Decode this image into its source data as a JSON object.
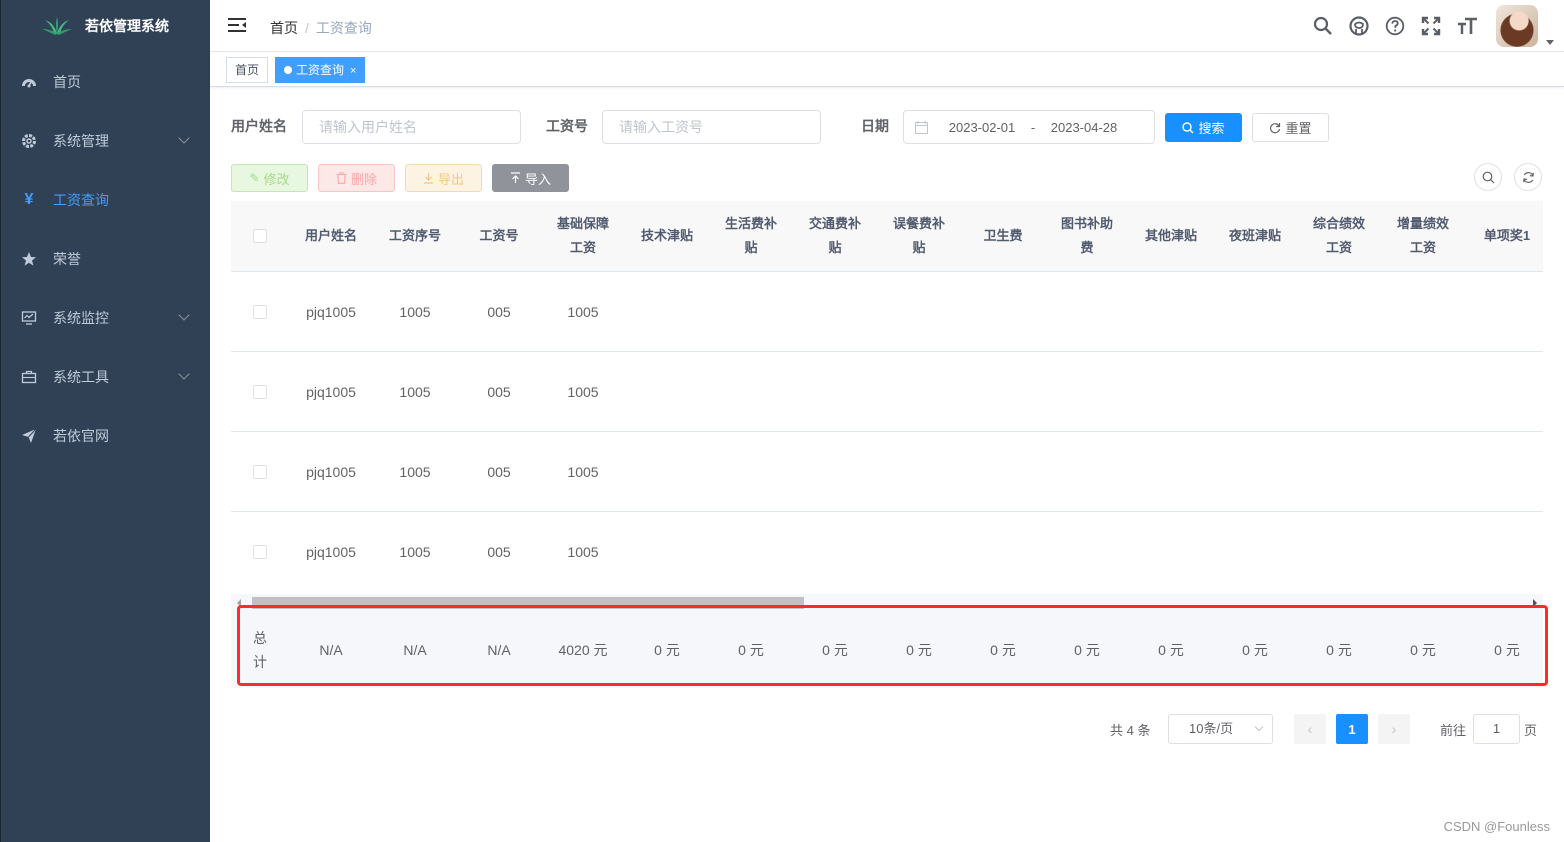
{
  "app": {
    "title": "若依管理系统"
  },
  "sidebar": {
    "items": [
      {
        "label": "首页"
      },
      {
        "label": "系统管理"
      },
      {
        "label": "工资查询"
      },
      {
        "label": "荣誉"
      },
      {
        "label": "系统监控"
      },
      {
        "label": "系统工具"
      },
      {
        "label": "若依官网"
      }
    ]
  },
  "breadcrumb": {
    "home": "首页",
    "sep": "/",
    "current": "工资查询"
  },
  "tags": {
    "home": "首页",
    "active": "工资查询",
    "close": "×"
  },
  "search": {
    "username_label": "用户姓名",
    "username_placeholder": "请输入用户姓名",
    "salary_no_label": "工资号",
    "salary_no_placeholder": "请输入工资号",
    "date_label": "日期",
    "date_start": "2023-02-01",
    "date_sep": "-",
    "date_end": "2023-04-28",
    "search_btn": "搜索",
    "reset_btn": "重置"
  },
  "toolbar": {
    "edit": "修改",
    "delete": "删除",
    "export": "导出",
    "import": "导入"
  },
  "table": {
    "columns": [
      "用户姓名",
      "工资序号",
      "工资号",
      "基础保障工资",
      "技术津贴",
      "生活费补贴",
      "交通费补贴",
      "误餐费补贴",
      "卫生费",
      "图书补助费",
      "其他津贴",
      "夜班津贴",
      "综合绩效工资",
      "增量绩效工资",
      "单项奖1"
    ],
    "rows": [
      [
        "pjq1005",
        "1005",
        "005",
        "1005"
      ],
      [
        "pjq1005",
        "1005",
        "005",
        "1005"
      ],
      [
        "pjq1005",
        "1005",
        "005",
        "1005"
      ],
      [
        "pjq1005",
        "1005",
        "005",
        "1005"
      ]
    ],
    "summary_label": "总计",
    "summary": [
      "N/A",
      "N/A",
      "N/A",
      "4020 元",
      "0 元",
      "0 元",
      "0 元",
      "0 元",
      "0 元",
      "0 元",
      "0 元",
      "0 元",
      "0 元",
      "0 元",
      "0 元"
    ]
  },
  "pagination": {
    "total": "共 4 条",
    "page_size": "10条/页",
    "current": "1",
    "goto": "前往",
    "goto_value": "1",
    "unit": "页"
  },
  "watermark": "CSDN @Founless",
  "colors": {
    "sidebar_bg": "#304156",
    "primary": "#1890ff",
    "highlight": "#ff2a2a"
  }
}
